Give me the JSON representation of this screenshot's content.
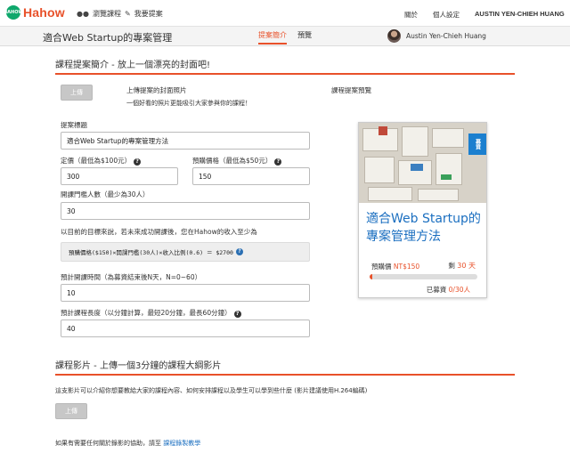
{
  "nav": {
    "logo_badge": "HAHOW",
    "logo_text": "Hahow",
    "browse": "瀏覽課程",
    "propose": "我要提案",
    "about": "關於",
    "settings": "個人設定",
    "user": "AUSTIN YEN-CHIEH HUANG"
  },
  "subheader": {
    "project_title": "適合Web Startup的專案管理",
    "tab_intro": "提案簡介",
    "tab_preview": "預覽",
    "user_name": "Austin Yen-Chieh Huang"
  },
  "intro_section": {
    "title": "課程提案簡介 - 放上一個漂亮的封面吧!",
    "upload_button": "上傳",
    "cover_label": "上傳提案的封面照片",
    "cover_hint": "一個好看的照片更能吸引大家參與你的課程！",
    "preview_label": "課程提案預覽"
  },
  "form": {
    "title_label": "提案標題",
    "title_value": "適合Web Startup的專案管理方法",
    "price_label": "定價（最低為$100元）",
    "price_value": "300",
    "presale_label": "預購價格（最低為$50元）",
    "presale_value": "150",
    "threshold_label": "開課門檻人數（最少為30人）",
    "threshold_value": "30",
    "income_note": "以目前的目標來說，若未來成功開課後，您在Hahow的收入至少為",
    "formula": "預購價格($150)×開課門檻(30人)×收入比例(0.6) ＝ $2700",
    "days_label": "預計開課時間（為募資結束後N天，N=0~60）",
    "days_value": "10",
    "length_label": "預計課程長度（以分鐘計算，最短20分鐘，最長60分鐘）",
    "length_value": "40"
  },
  "video_section": {
    "title": "課程影片 - 上傳一個3分鐘的課程大綱影片",
    "description": "這支影片可以介紹你想要教給大家的課程內容、如何安排課程以及學生可以學到些什麼 (影片建議使用H.264編碼)",
    "upload_button": "上傳",
    "help_text": "如果有需要任何關於錄影的協助，請至",
    "help_link": "課程錄製教學"
  },
  "preview_card": {
    "ribbon": "募資",
    "title": "適合Web Startup的專案管理方法",
    "presale_label": "預購價",
    "presale_price": "NT$150",
    "days_prefix": "剩",
    "days_value": "30 天",
    "raised_prefix": "已募資",
    "raised_value": "0/30人",
    "progress": 0
  },
  "colors": {
    "accent": "#e8512a",
    "link": "#1b6fc0",
    "logo_badge": "#0fa86c"
  }
}
